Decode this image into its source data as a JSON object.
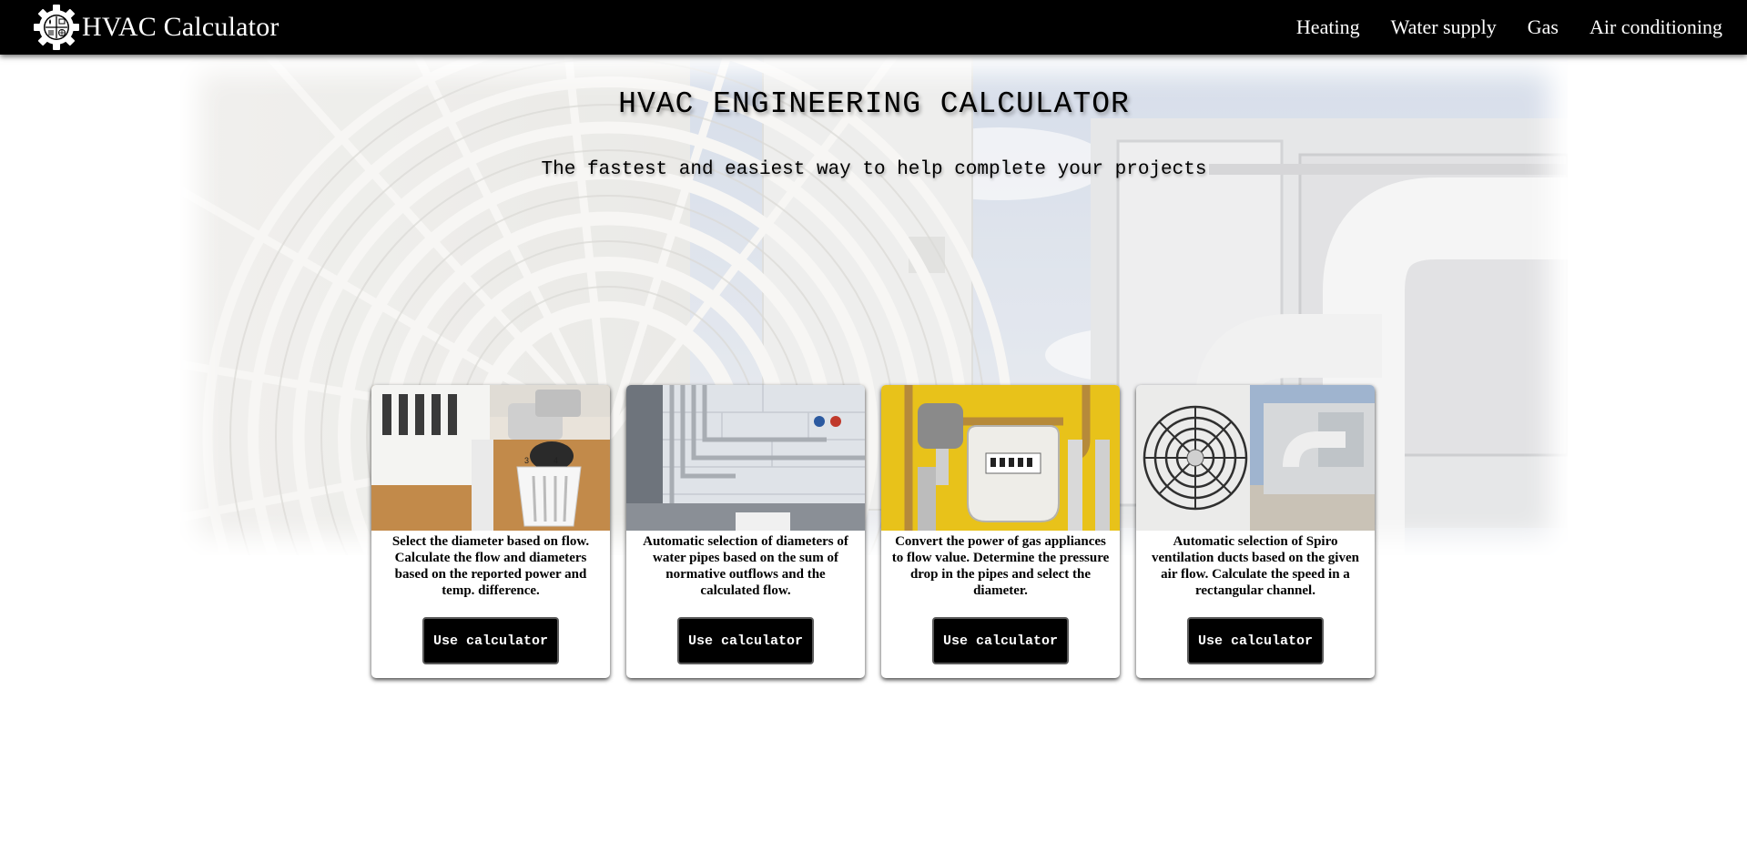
{
  "navbar": {
    "brand": "HVAC Calculator",
    "links": [
      "Heating",
      "Water supply",
      "Gas",
      "Air conditioning"
    ]
  },
  "hero": {
    "title": "HVAC ENGINEERING CALCULATOR",
    "subtitle": "The fastest and easiest way to help complete your projects"
  },
  "cards": [
    {
      "image": "radiator-thermostatic-valve",
      "text": "Select the diameter based on flow. Calculate the flow and diameters based on the reported power and temp. difference.",
      "button": "Use calculator"
    },
    {
      "image": "water-pipes",
      "text": "Automatic selection of diameters of water pipes based on the sum of normative outflows and the calculated flow.",
      "button": "Use calculator"
    },
    {
      "image": "gas-meter",
      "text": "Convert the power of gas appliances to flow value. Determine the pressure drop in the pipes and select the diameter.",
      "button": "Use calculator"
    },
    {
      "image": "air-conditioning-unit",
      "text": "Automatic selection of Spiro ventilation ducts based on the given air flow. Calculate the speed in a rectangular channel.",
      "button": "Use calculator"
    }
  ],
  "colors": {
    "navbar_bg": "#000000",
    "nav_text": "#ffffff",
    "button_bg": "#000000",
    "button_text": "#ffffff",
    "card_bg": "#ffffff"
  }
}
